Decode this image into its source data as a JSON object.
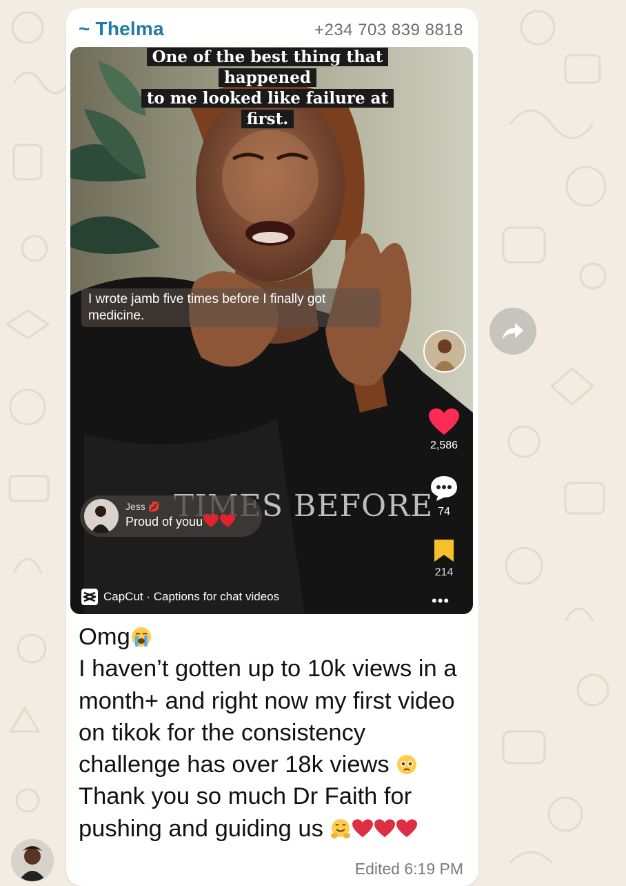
{
  "chat": {
    "sender_name": "~ Thelma",
    "sender_phone": "+234 703 839 8818",
    "message_lines": [
      "Omg",
      "I haven’t gotten up to 10k views in a month+ and right now my first video on tikok for the consistency challenge has over 18k views",
      "Thank you so much Dr Faith for pushing and guiding us"
    ],
    "edited_label": "Edited",
    "time": "6:19 PM"
  },
  "video": {
    "top_caption_line1": "One of the best thing that happened",
    "top_caption_line2": "to me looked like failure at first.",
    "subtitle": "I wrote jamb five times before I finally got medicine.",
    "overlay_word": "TIMES BEFORE",
    "like_count": "2,586",
    "comment_count": "74",
    "save_count": "214",
    "comment_user": "Jess",
    "comment_text": "Proud of youu",
    "watermark": "CapCut · Captions for chat videos"
  },
  "icons": {
    "forward": "forward-arrow-icon",
    "like": "heart-icon",
    "comment": "speech-bubble-icon",
    "save": "bookmark-icon",
    "capcut": "capcut-logo-icon"
  },
  "colors": {
    "wallpaper": "#f2ece2",
    "sender_name": "#1f7aa7",
    "like_red": "#fe2c55",
    "save_yellow": "#f7c02a"
  }
}
